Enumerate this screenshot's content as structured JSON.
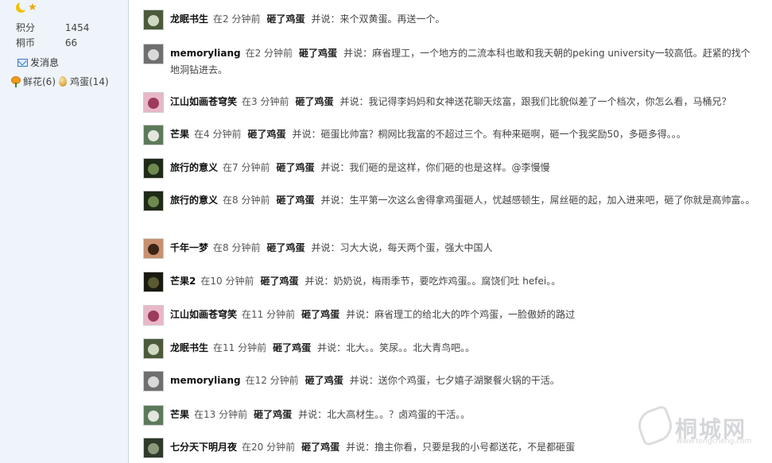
{
  "sidebar": {
    "stats": [
      {
        "label": "积分",
        "value": "1454"
      },
      {
        "label": "桐币",
        "value": "66"
      }
    ],
    "message_label": "发消息",
    "flowers_label": "鲜花(6)",
    "eggs_label": "鸡蛋(14)"
  },
  "feed": {
    "said_label": "并说：",
    "items": [
      {
        "user": "龙眠书生",
        "time": "在2 分钟前",
        "action": "砸了鸡蛋",
        "text": "来个双黄蛋。再送一个。",
        "avatar_colors": [
          "#4b5a3a",
          "#cfd8c0"
        ]
      },
      {
        "user": "memoryliang",
        "time": "在2 分钟前",
        "action": "砸了鸡蛋",
        "text": "麻省理工，一个地方的二流本科也敢和我天朝的peking university一较高低。赶紧的找个地洞钻进去。",
        "avatar_colors": [
          "#6f6f6f",
          "#d9d9d9"
        ]
      },
      {
        "user": "江山如画苍穹笑",
        "time": "在3 分钟前",
        "action": "砸了鸡蛋",
        "text": "我记得李妈妈和女神送花聊天炫富，跟我们比貌似差了一个档次，你怎么看，马桶兄？",
        "avatar_colors": [
          "#e8b8c8",
          "#9c3b5c"
        ]
      },
      {
        "user": "芒果",
        "time": "在4 分钟前",
        "action": "砸了鸡蛋",
        "text": "砸蛋比帅富？桐网比我富的不超过三个。有种来砸啊，砸一个我奖励50，多砸多得。。。",
        "avatar_colors": [
          "#5c7a5a",
          "#e2e6dc"
        ]
      },
      {
        "user": "旅行的意义",
        "time": "在7 分钟前",
        "action": "砸了鸡蛋",
        "text": "我们砸的是这样，你们砸的也是这样。@李慢慢",
        "avatar_colors": [
          "#1f2a18",
          "#6e8a4e"
        ]
      },
      {
        "user": "旅行的意义",
        "time": "在8 分钟前",
        "action": "砸了鸡蛋",
        "text": "生平第一次这么舍得拿鸡蛋砸人，忧越感顿生，屌丝砸的起，加入进来吧，砸了你就是高帅富。。",
        "avatar_colors": [
          "#1f2a18",
          "#6e8a4e"
        ]
      },
      {
        "user": "千年一梦",
        "time": "在8 分钟前",
        "action": "砸了鸡蛋",
        "text": "习大大说，每天两个蛋，强大中国人",
        "avatar_colors": [
          "#c89070",
          "#3a2418"
        ]
      },
      {
        "user": "芒果2",
        "time": "在10 分钟前",
        "action": "砸了鸡蛋",
        "text": "奶奶说，梅雨季节，要吃炸鸡蛋。。腐饶们吐 hefei。。",
        "avatar_colors": [
          "#1a1a10",
          "#5a5a30"
        ]
      },
      {
        "user": "江山如画苍穹笑",
        "time": "在11 分钟前",
        "action": "砸了鸡蛋",
        "text": "麻省理工的给北大的咋个鸡蛋，一脸傲娇的路过",
        "avatar_colors": [
          "#e8b8c8",
          "#9c3b5c"
        ]
      },
      {
        "user": "龙眠书生",
        "time": "在11 分钟前",
        "action": "砸了鸡蛋",
        "text": "北大。。笑尿。。北大青鸟吧。。",
        "avatar_colors": [
          "#4b5a3a",
          "#cfd8c0"
        ]
      },
      {
        "user": "memoryliang",
        "time": "在12 分钟前",
        "action": "砸了鸡蛋",
        "text": "送你个鸡蛋，七夕嬉子湖聚餐火锅的干活。",
        "avatar_colors": [
          "#6f6f6f",
          "#d9d9d9"
        ]
      },
      {
        "user": "芒果",
        "time": "在13 分钟前",
        "action": "砸了鸡蛋",
        "text": "北大高材生。。？卤鸡蛋的干活。。",
        "avatar_colors": [
          "#5c7a5a",
          "#e2e6dc"
        ]
      },
      {
        "user": "七分天下明月夜",
        "time": "在20 分钟前",
        "action": "砸了鸡蛋",
        "text": "撸主你看，只要是我的小号都送花，不是都砸蛋",
        "avatar_colors": [
          "#2f3a2a",
          "#8a9a7a"
        ]
      }
    ]
  },
  "watermark": {
    "name": "桐城网",
    "url": "www.tongcheng.com"
  }
}
